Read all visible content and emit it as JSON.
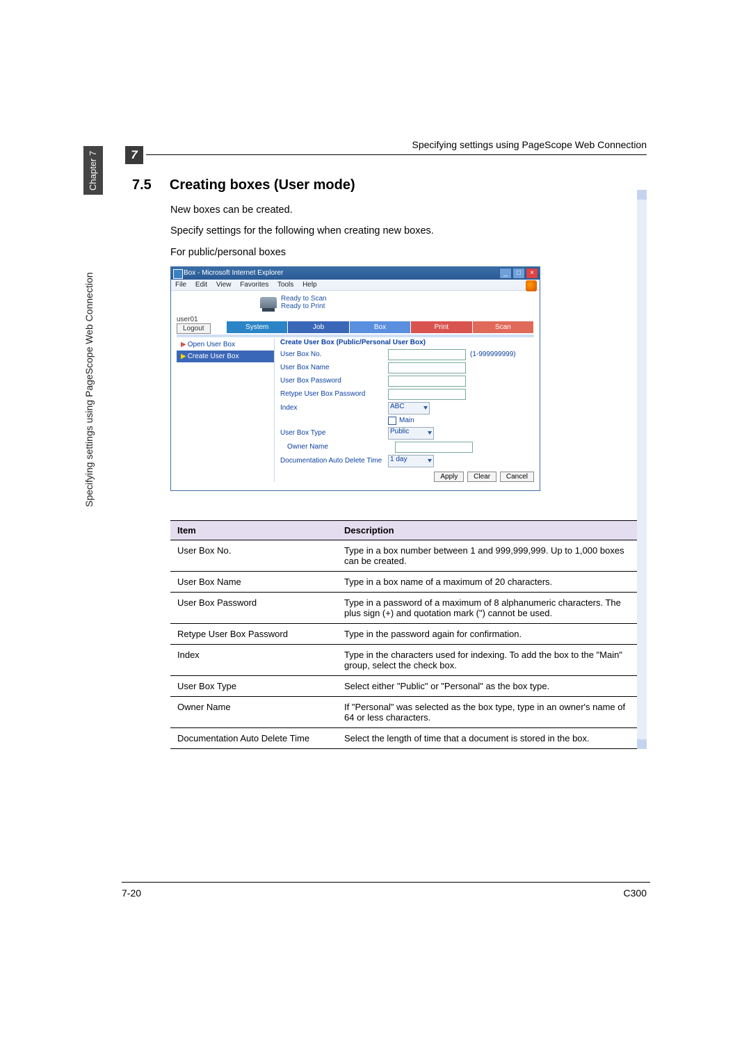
{
  "header": {
    "running_title": "Specifying settings using PageScope Web Connection",
    "chapter_badge": "7"
  },
  "side": {
    "chapter_label": "Chapter 7",
    "side_title": "Specifying settings using PageScope Web Connection"
  },
  "section": {
    "number": "7.5",
    "title": "Creating boxes (User mode)"
  },
  "body": {
    "p1": "New boxes can be created.",
    "p2": "Specify settings for the following when creating new boxes.",
    "p3": "For public/personal boxes"
  },
  "screenshot": {
    "window_title": "Box - Microsoft Internet Explorer",
    "menu": {
      "file": "File",
      "edit": "Edit",
      "view": "View",
      "favorites": "Favorites",
      "tools": "Tools",
      "help": "Help"
    },
    "status": {
      "scan": "Ready to Scan",
      "print": "Ready to Print"
    },
    "user": "user01",
    "logout": "Logout",
    "tabs": {
      "system": "System",
      "job": "Job",
      "box": "Box",
      "print": "Print",
      "scan": "Scan"
    },
    "left_nav": {
      "open": "Open User Box",
      "create": "Create User Box"
    },
    "form": {
      "head": "Create User Box (Public/Personal User Box)",
      "user_box_no": "User Box No.",
      "user_box_no_hint": "(1-999999999)",
      "user_box_name": "User Box Name",
      "user_box_password": "User Box Password",
      "retype_password": "Retype User Box Password",
      "index": "Index",
      "index_value": "ABC",
      "main_checkbox": "Main",
      "user_box_type": "User Box Type",
      "type_value": "Public",
      "owner_name": "Owner Name",
      "doc_auto_delete": "Documentation Auto Delete Time",
      "delete_value": "1 day"
    },
    "buttons": {
      "apply": "Apply",
      "clear": "Clear",
      "cancel": "Cancel"
    }
  },
  "table": {
    "head_item": "Item",
    "head_desc": "Description",
    "rows": [
      {
        "item": "User Box No.",
        "desc": "Type in a box number between 1 and 999,999,999. Up to 1,000 boxes can be created."
      },
      {
        "item": "User Box Name",
        "desc": "Type in a box name of a maximum of 20 characters."
      },
      {
        "item": "User Box Password",
        "desc": "Type in a password of a maximum of 8 alphanumeric characters. The plus sign (+) and quotation mark (\") cannot be used."
      },
      {
        "item": "Retype User Box Password",
        "desc": "Type in the password again for confirmation."
      },
      {
        "item": "Index",
        "desc": "Type in the characters used for indexing. To add the box to the \"Main\" group, select the check box."
      },
      {
        "item": "User Box Type",
        "desc": "Select either \"Public\" or \"Personal\" as the box type."
      },
      {
        "item": "Owner Name",
        "desc": "If \"Personal\" was selected as the box type, type in an owner's name of 64 or less characters."
      },
      {
        "item": "Documentation Auto Delete Time",
        "desc": "Select the length of time that a document is stored in the box."
      }
    ]
  },
  "footer": {
    "page": "7-20",
    "model": "C300"
  }
}
